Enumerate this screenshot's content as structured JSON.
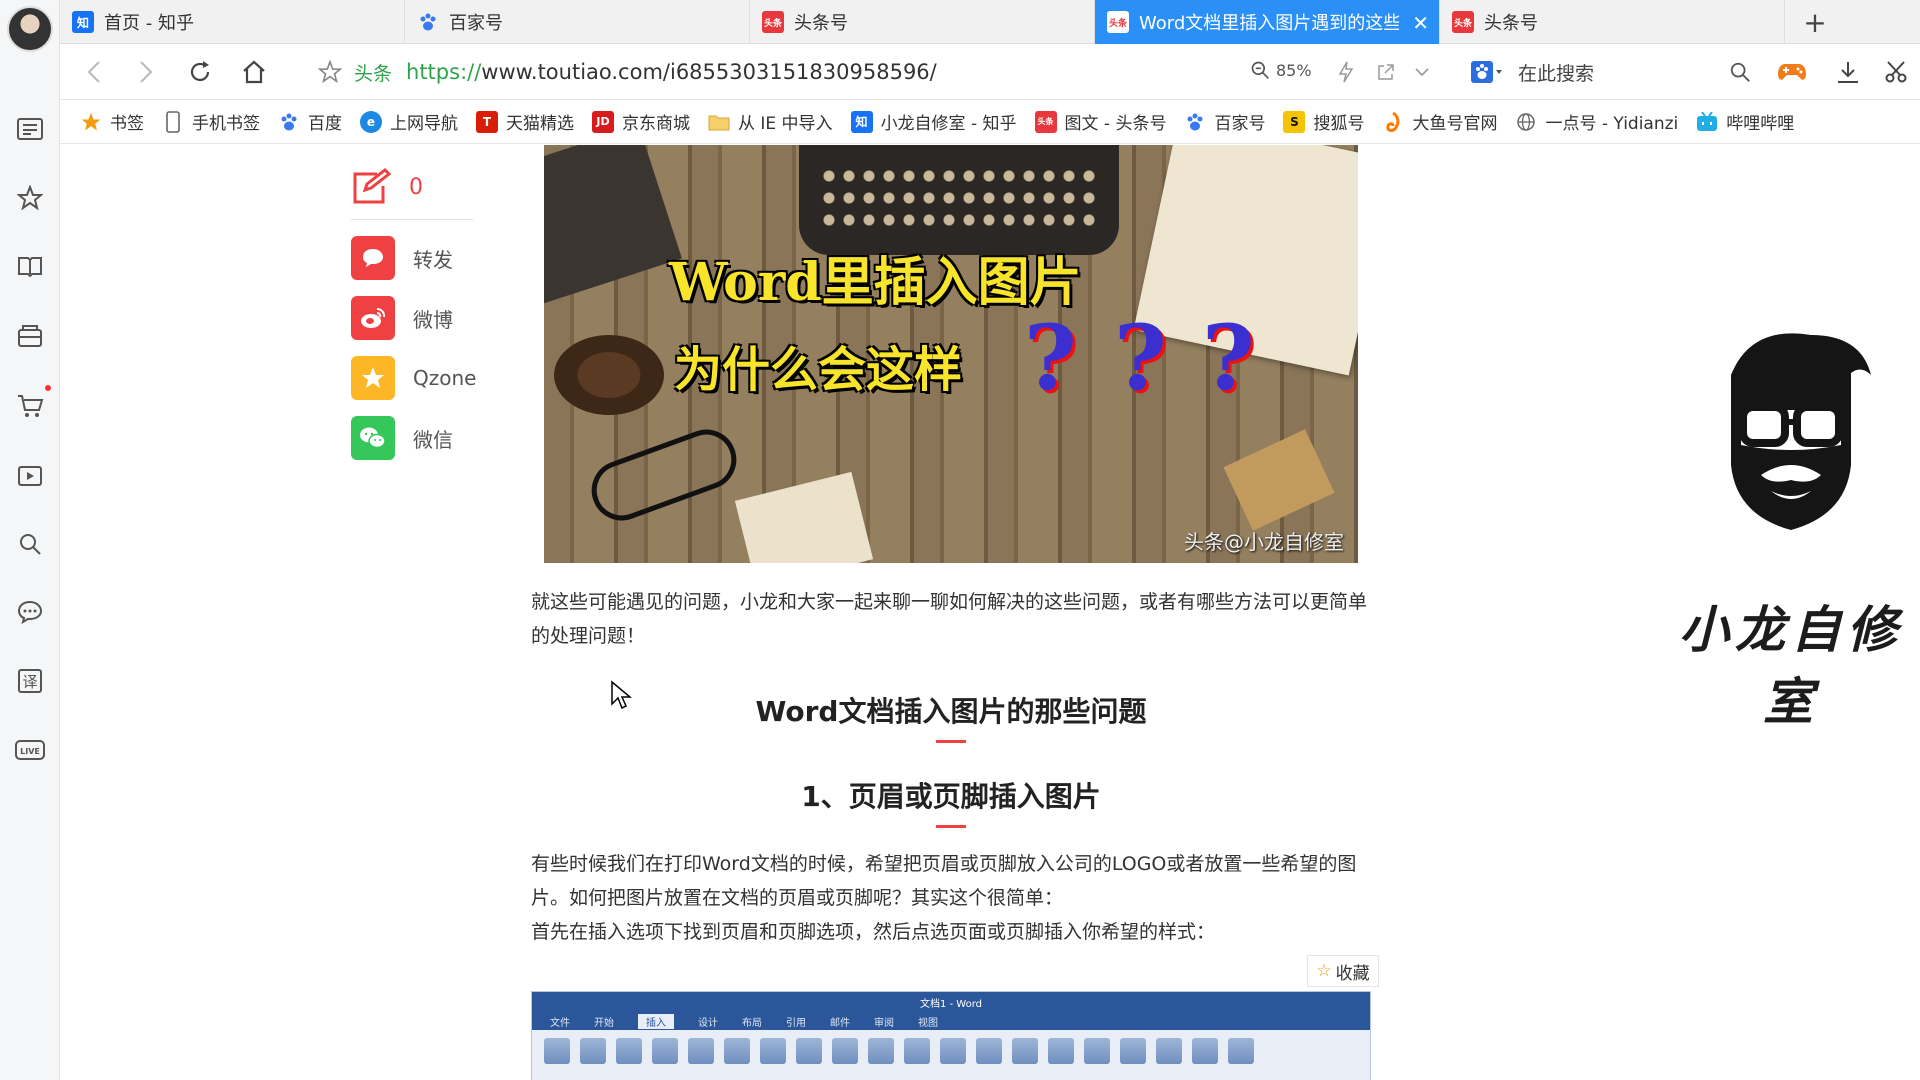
{
  "tabs": [
    {
      "label": "首页 - 知乎",
      "icon": "zhihu-icon",
      "active": false
    },
    {
      "label": "百家号",
      "icon": "baijiahao-icon",
      "active": false
    },
    {
      "label": "头条号",
      "icon": "toutiao-icon",
      "active": false
    },
    {
      "label": "Word文档里插入图片遇到的这些",
      "icon": "toutiao-icon",
      "active": true
    },
    {
      "label": "头条号",
      "icon": "toutiao-icon",
      "active": false
    }
  ],
  "address": {
    "tag": "头条",
    "url_proto": "https://",
    "url_rest": "www.toutiao.com/i6855303151830958596/",
    "zoom": "85%",
    "search_placeholder": "在此搜索"
  },
  "bookmarks": [
    {
      "label": "书签",
      "icon": "star-icon"
    },
    {
      "label": "手机书签",
      "icon": "phone-icon"
    },
    {
      "label": "百度",
      "icon": "baidu-icon"
    },
    {
      "label": "上网导航",
      "icon": "ie-icon"
    },
    {
      "label": "天猫精选",
      "icon": "tmall-icon"
    },
    {
      "label": "京东商城",
      "icon": "jd-icon"
    },
    {
      "label": "从 IE 中导入",
      "icon": "folder-icon"
    },
    {
      "label": "小龙自修室 - 知乎",
      "icon": "zhihu-icon"
    },
    {
      "label": "图文 - 头条号",
      "icon": "toutiao-icon"
    },
    {
      "label": "百家号",
      "icon": "baijiahao-icon"
    },
    {
      "label": "搜狐号",
      "icon": "sohu-icon"
    },
    {
      "label": "大鱼号官网",
      "icon": "dayu-icon"
    },
    {
      "label": "一点号 - Yidianzi",
      "icon": "globe-icon"
    },
    {
      "label": "哔哩哔哩",
      "icon": "bilibili-icon"
    }
  ],
  "share": {
    "comment_count": "0",
    "items": [
      {
        "label": "转发",
        "icon": "repost-icon",
        "color": "#f04142"
      },
      {
        "label": "微博",
        "icon": "weibo-icon",
        "color": "#f04142"
      },
      {
        "label": "Qzone",
        "icon": "qzone-icon",
        "color": "#fcb626"
      },
      {
        "label": "微信",
        "icon": "wechat-icon",
        "color": "#36c75a"
      }
    ]
  },
  "hero": {
    "line1": "Word里插入图片",
    "line2": "为什么会这样",
    "marks": [
      "?",
      "?",
      "?"
    ],
    "watermark": "头条@小龙自修室"
  },
  "article": {
    "intro": "就这些可能遇见的问题，小龙和大家一起来聊一聊如何解决的这些问题，或者有哪些方法可以更简单的处理问题！",
    "heading": "Word文档插入图片的那些问题",
    "subheading": "1、页眉或页脚插入图片",
    "para1": "有些时候我们在打印Word文档的时候，希望把页眉或页脚放入公司的LOGO或者放置一些希望的图片。如何把图片放置在文档的页眉或页脚呢？其实这个很简单：",
    "para2": "首先在插入选项下找到页眉和页脚选项，然后点选页面或页脚插入你希望的样式：",
    "favorite": "收藏",
    "screenshot_title": "文档1 - Word",
    "screenshot_tabs": [
      "文件",
      "开始",
      "插入",
      "设计",
      "布局",
      "引用",
      "邮件",
      "审阅",
      "视图"
    ]
  },
  "author": {
    "name": "小龙自修室"
  },
  "colors": {
    "accent": "#2a8ff7",
    "toutiao_red": "#f04142",
    "url_green": "#2fa34a"
  }
}
